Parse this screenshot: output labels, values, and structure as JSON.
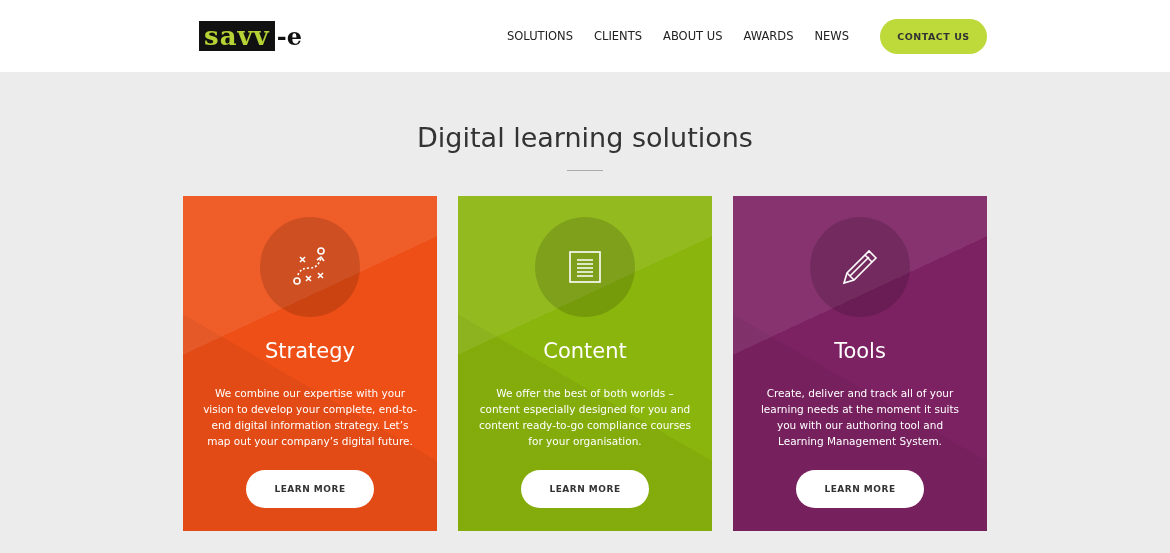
{
  "header": {
    "logo": {
      "mark": "savv",
      "suffix": "-e"
    },
    "nav": [
      {
        "label": "SOLUTIONS"
      },
      {
        "label": "CLIENTS"
      },
      {
        "label": "ABOUT US"
      },
      {
        "label": "AWARDS"
      },
      {
        "label": "NEWS"
      }
    ],
    "cta": "CONTACT US"
  },
  "section": {
    "title": "Digital learning solutions",
    "cards": [
      {
        "kind": "strategy",
        "color": "#ee4f16",
        "title": "Strategy",
        "text": "We combine our expertise with your vision to develop your complete, end-to-end digital information strategy. Let’s map out your company’s digital future.",
        "button": "LEARN MORE"
      },
      {
        "kind": "content",
        "color": "#8ab50c",
        "title": "Content",
        "text": "We offer the best of both worlds – content especially designed for you and content ready-to-go compliance courses for your organisation.",
        "button": "LEARN MORE"
      },
      {
        "kind": "tools",
        "color": "#7c2263",
        "title": "Tools",
        "text": "Create, deliver and track all of your learning needs at the moment it suits you with our authoring tool and Learning Management System.",
        "button": "LEARN MORE"
      }
    ]
  }
}
